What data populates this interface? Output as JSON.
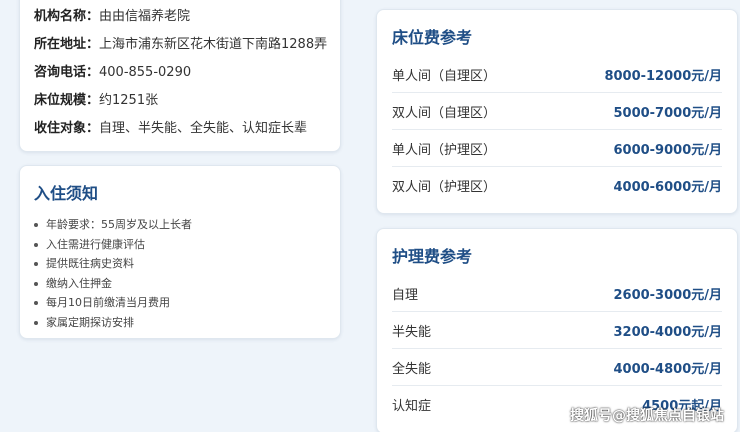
{
  "info": {
    "rows": [
      {
        "label": "机构名称：",
        "value": "由由信福养老院"
      },
      {
        "label": "所在地址：",
        "value": "上海市浦东新区花木街道下南路1288弄"
      },
      {
        "label": "咨询电话：",
        "value": "400-855-0290"
      },
      {
        "label": "床位规模：",
        "value": "约1251张"
      },
      {
        "label": "收住对象：",
        "value": "自理、半失能、全失能、认知症长辈"
      }
    ]
  },
  "notice": {
    "title": "入住须知",
    "items": [
      "年龄要求：55周岁及以上长者",
      "入住需进行健康评估",
      "提供既往病史资料",
      "缴纳入住押金",
      "每月10日前缴清当月费用",
      "家属定期探访安排"
    ]
  },
  "bed": {
    "title": "床位费参考",
    "rows": [
      {
        "name": "单人间（自理区）",
        "price": "8000-12000元/月"
      },
      {
        "name": "双人间（自理区）",
        "price": "5000-7000元/月"
      },
      {
        "name": "单人间（护理区）",
        "price": "6000-9000元/月"
      },
      {
        "name": "双人间（护理区）",
        "price": "4000-6000元/月"
      }
    ]
  },
  "care": {
    "title": "护理费参考",
    "rows": [
      {
        "name": "自理",
        "price": "2600-3000元/月"
      },
      {
        "name": "半失能",
        "price": "3200-4000元/月"
      },
      {
        "name": "全失能",
        "price": "4000-4800元/月"
      },
      {
        "name": "认知症",
        "price": "4500元起/月"
      }
    ]
  },
  "watermark": "搜狐号@搜狐焦点自银站",
  "colors": {
    "accent": "#1f4e86",
    "page_bg": "#eef4fa",
    "card_bg": "#ffffff"
  }
}
